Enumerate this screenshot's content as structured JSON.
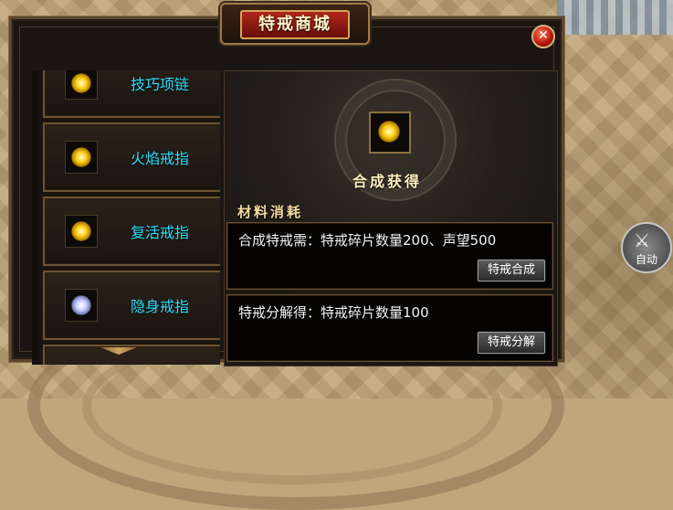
{
  "window": {
    "title": "特戒商城",
    "close_symbol": "✕"
  },
  "list": {
    "items": [
      {
        "label": "技巧项链",
        "icon": "gold-gem-icon"
      },
      {
        "label": "火焰戒指",
        "icon": "gold-gem-icon"
      },
      {
        "label": "复活戒指",
        "icon": "gold-gem-icon"
      },
      {
        "label": "隐身戒指",
        "icon": "silver-gem-icon"
      },
      {
        "label": "",
        "icon": "partial-item"
      }
    ]
  },
  "panel": {
    "result_label": "合成获得",
    "materials_label": "材料消耗",
    "recipes": [
      {
        "text": "合成特戒需：特戒碎片数量200、声望500",
        "button": "特戒合成"
      },
      {
        "text": "特戒分解得：特戒碎片数量100",
        "button": "特戒分解"
      }
    ]
  },
  "hud": {
    "auto_label": "自动",
    "auto_icon": "crossed-swords-icon"
  },
  "colors": {
    "item_label": "#2ce0ff",
    "title_red": "#b0251b",
    "border_gold": "#a07a46"
  }
}
